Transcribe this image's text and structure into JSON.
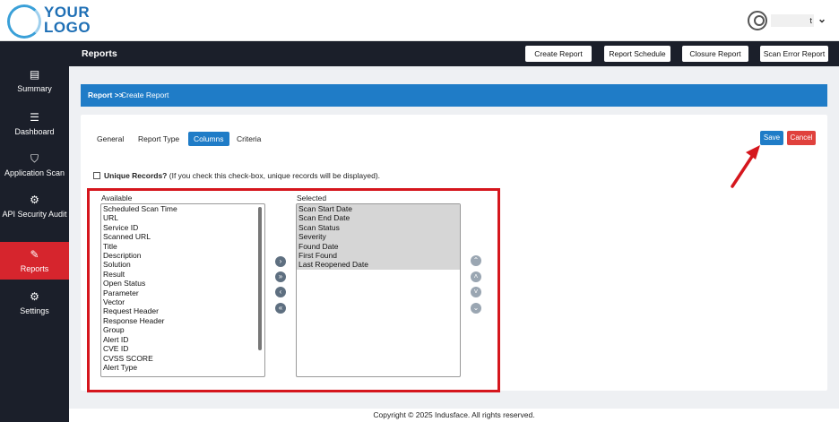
{
  "logo": {
    "line1": "YOUR",
    "line2": "LOGO"
  },
  "user": {
    "name": "t",
    "menu_icon": "chevron-down-icon"
  },
  "sidebar": {
    "items": [
      {
        "label": "Summary",
        "icon": "summary-icon",
        "glyph": "▤"
      },
      {
        "label": "Dashboard",
        "icon": "dashboard-icon",
        "glyph": "☰"
      },
      {
        "label": "Application Scan",
        "icon": "shield-icon",
        "glyph": "⛉"
      },
      {
        "label": "API Security Audit",
        "icon": "api-icon",
        "glyph": "⚙"
      },
      {
        "label": "Reports",
        "icon": "edit-icon",
        "glyph": "✎",
        "active": true
      },
      {
        "label": "Settings",
        "icon": "gear-icon",
        "glyph": "⚙"
      }
    ]
  },
  "header": {
    "title": "Reports",
    "buttons": [
      "Create Report",
      "Report Schedule",
      "Closure Report",
      "Scan Error Report"
    ]
  },
  "breadcrumb": {
    "root": "Report >>",
    "current": "Create Report"
  },
  "tabs": [
    "General",
    "Report Type",
    "Columns",
    "Criteria"
  ],
  "active_tab": "Columns",
  "actions": {
    "save": "Save",
    "cancel": "Cancel"
  },
  "unique_records": {
    "label": "Unique Records?",
    "hint": "(If you check this check-box, unique records will be displayed).",
    "checked": false
  },
  "available": {
    "label": "Available",
    "items": [
      "Scheduled Scan Time",
      "URL",
      "Service ID",
      "Scanned URL",
      "Title",
      "Description",
      "Solution",
      "Result",
      "Open Status",
      "Parameter",
      "Vector",
      "Request Header",
      "Response Header",
      "Group",
      "Alert ID",
      "CVE ID",
      "CVSS SCORE",
      "Alert Type"
    ]
  },
  "selected": {
    "label": "Selected",
    "items": [
      "Scan Start Date",
      "Scan End Date",
      "Scan Status",
      "Severity",
      "Found Date",
      "First Found",
      "Last Reopened Date"
    ]
  },
  "transfer_buttons": [
    "move-right-icon",
    "move-all-right-icon",
    "move-left-icon",
    "move-all-left-icon"
  ],
  "order_buttons": [
    "move-top-icon",
    "move-up-icon",
    "move-down-icon",
    "move-bottom-icon"
  ],
  "footer": "Copyright © 2025 Indusface. All rights reserved.",
  "colors": {
    "accent": "#1f7cc7",
    "active_nav": "#d6252d",
    "sidebar": "#1b1f2a",
    "highlight": "#d5161d"
  }
}
